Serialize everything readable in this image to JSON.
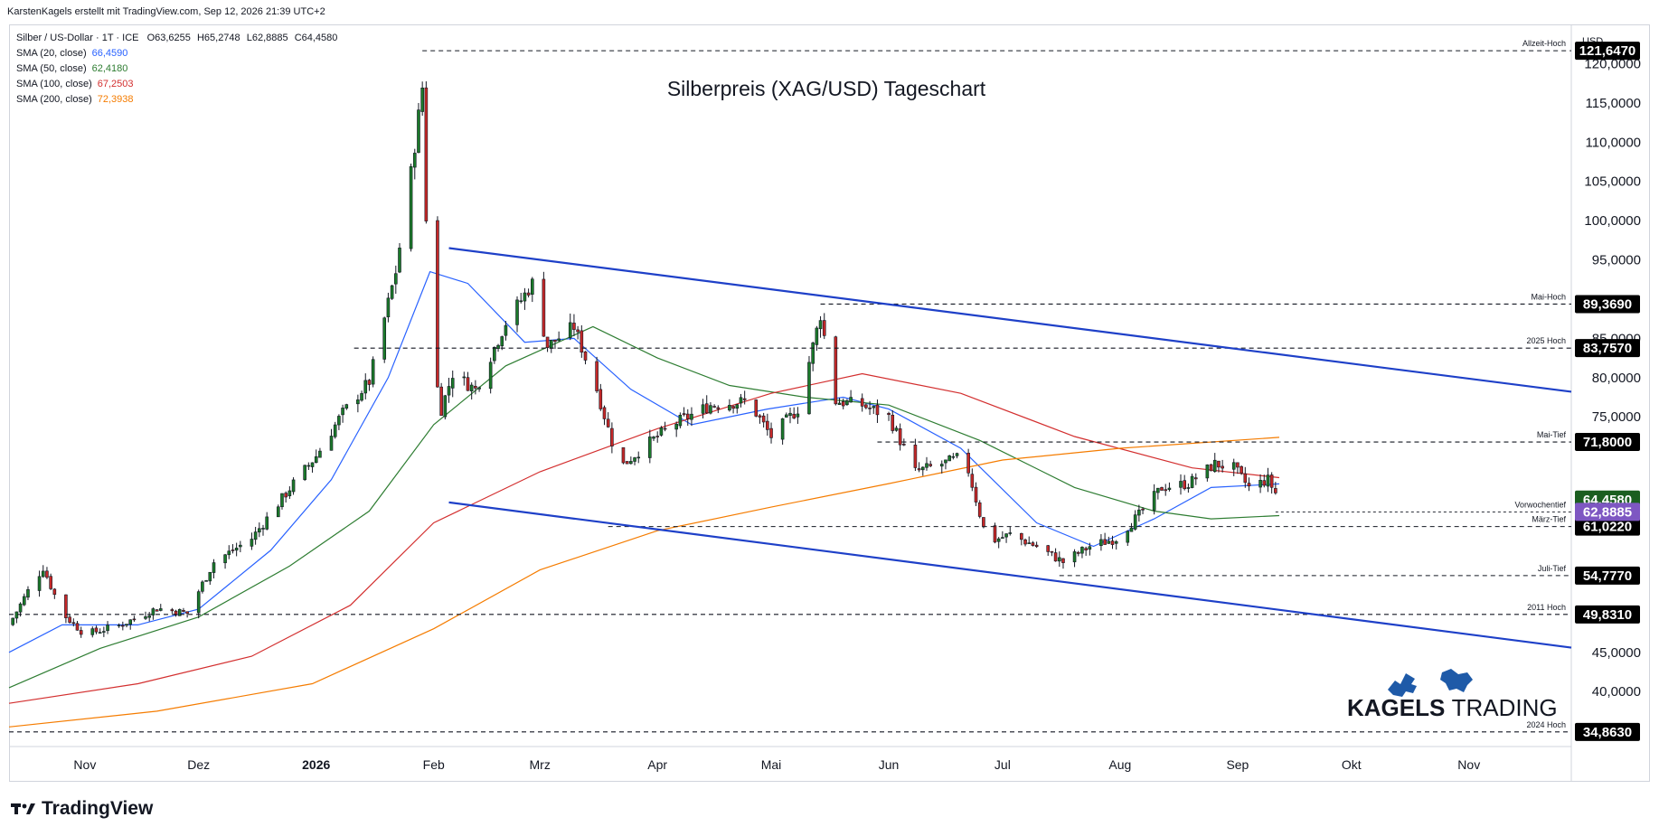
{
  "header": {
    "attribution": "KarstenKagels erstellt mit TradingView.com, Sep 12, 2026 21:39 UTC+2"
  },
  "legend": {
    "symbol_line": "Silber / US-Dollar · 1T · ICE",
    "ohlc": {
      "o": "O63,6255",
      "h": "H65,2748",
      "l": "L62,8885",
      "c": "C64,4580"
    },
    "sma": [
      {
        "label": "SMA (20, close)",
        "value": "66,4590",
        "color": "#2962ff"
      },
      {
        "label": "SMA (50, close)",
        "value": "62,4180",
        "color": "#2e7d32"
      },
      {
        "label": "SMA (100, close)",
        "value": "67,2503",
        "color": "#d32f2f"
      },
      {
        "label": "SMA (200, close)",
        "value": "72,3938",
        "color": "#f57c00"
      }
    ]
  },
  "footer": {
    "brand": "TradingView"
  },
  "watermark": {
    "word1": "KAGELS",
    "word2": "TRADING"
  },
  "chart_data": {
    "type": "candlestick",
    "title": "Silberpreis (XAG/USD) Tageschart",
    "currency_label": "USD",
    "ylim": [
      33,
      125
    ],
    "xlim": [
      "2025-10-12",
      "2026-11-28"
    ],
    "x_ticks": [
      {
        "label": "Nov",
        "date": "2025-11-01"
      },
      {
        "label": "Dez",
        "date": "2025-12-01"
      },
      {
        "label": "2026",
        "date": "2026-01-01",
        "bold": true
      },
      {
        "label": "Feb",
        "date": "2026-02-01"
      },
      {
        "label": "Mrz",
        "date": "2026-03-01"
      },
      {
        "label": "Apr",
        "date": "2026-04-01"
      },
      {
        "label": "Mai",
        "date": "2026-05-01"
      },
      {
        "label": "Jun",
        "date": "2026-06-01"
      },
      {
        "label": "Jul",
        "date": "2026-07-01"
      },
      {
        "label": "Aug",
        "date": "2026-08-01"
      },
      {
        "label": "Sep",
        "date": "2026-09-01"
      },
      {
        "label": "Okt",
        "date": "2026-10-01"
      },
      {
        "label": "Nov",
        "date": "2026-11-01"
      }
    ],
    "y_ticks": [
      {
        "v": 40,
        "label": "40,0000"
      },
      {
        "v": 45,
        "label": "45,0000"
      },
      {
        "v": 75,
        "label": "75,0000"
      },
      {
        "v": 80,
        "label": "80,0000"
      },
      {
        "v": 85,
        "label": "85,0000"
      },
      {
        "v": 95,
        "label": "95,0000"
      },
      {
        "v": 100,
        "label": "100,0000"
      },
      {
        "v": 105,
        "label": "105,0000"
      },
      {
        "v": 110,
        "label": "110,0000"
      },
      {
        "v": 115,
        "label": "115,0000"
      },
      {
        "v": 120,
        "label": "120,0000"
      }
    ],
    "levels": [
      {
        "name": "Allzeit-Hoch",
        "value": 121.647,
        "label": "121,6470",
        "start": "2026-01-29"
      },
      {
        "name": "Mai-Hoch",
        "value": 89.369,
        "label": "89,3690",
        "start": "2026-05-14"
      },
      {
        "name": "2025 Hoch",
        "value": 83.757,
        "label": "83,7570",
        "start": "2026-01-11"
      },
      {
        "name": "Mai-Tief",
        "value": 71.8,
        "label": "71,8000",
        "start": "2026-05-29"
      },
      {
        "name": "Vorwochentief",
        "value": 62.8885,
        "label": "",
        "start": "2026-09-11",
        "thin": true
      },
      {
        "name": "März-Tief",
        "value": 61.022,
        "label": "61,0220",
        "start": "2026-03-19"
      },
      {
        "name": "Juli-Tief",
        "value": 54.777,
        "label": "54,7770",
        "start": "2026-07-16"
      },
      {
        "name": "2011 Hoch",
        "value": 49.831,
        "label": "49,8310",
        "start": "2025-10-12"
      },
      {
        "name": "2024 Hoch",
        "value": 34.863,
        "label": "34,8630",
        "start": "2025-10-12"
      }
    ],
    "price_tags": [
      {
        "value": 64.458,
        "label": "64,4580",
        "color": "#1b5e20"
      },
      {
        "value": 62.8885,
        "label": "62,8885",
        "color": "#7e57c2"
      }
    ],
    "channel_lines": [
      {
        "from": [
          "2026-02-05",
          96.5
        ],
        "to": [
          "2026-11-28",
          78.2
        ]
      },
      {
        "from": [
          "2026-02-05",
          64.1
        ],
        "to": [
          "2026-11-28",
          45.6
        ]
      }
    ],
    "candles_keypoints": [
      [
        "2025-10-12",
        48.5
      ],
      [
        "2025-10-17",
        52.8
      ],
      [
        "2025-10-21",
        55.8
      ],
      [
        "2025-10-26",
        50.0
      ],
      [
        "2025-11-01",
        47.3
      ],
      [
        "2025-11-10",
        48.4
      ],
      [
        "2025-11-20",
        50.6
      ],
      [
        "2025-11-28",
        50.0
      ],
      [
        "2025-12-05",
        56.5
      ],
      [
        "2025-12-15",
        59.5
      ],
      [
        "2025-12-26",
        66.5
      ],
      [
        "2026-01-01",
        70.0
      ],
      [
        "2026-01-08",
        75.5
      ],
      [
        "2026-01-15",
        79.5
      ],
      [
        "2026-01-22",
        93.5
      ],
      [
        "2026-01-26",
        106.0
      ],
      [
        "2026-01-29",
        117.0
      ],
      [
        "2026-01-31",
        84.0
      ],
      [
        "2026-02-03",
        76.0
      ],
      [
        "2026-02-06",
        80.5
      ],
      [
        "2026-02-12",
        78.5
      ],
      [
        "2026-02-20",
        87.0
      ],
      [
        "2026-02-27",
        92.0
      ],
      [
        "2026-03-03",
        84.0
      ],
      [
        "2026-03-10",
        86.5
      ],
      [
        "2026-03-16",
        78.5
      ],
      [
        "2026-03-22",
        68.5
      ],
      [
        "2026-03-28",
        71.0
      ],
      [
        "2026-04-05",
        74.0
      ],
      [
        "2026-04-15",
        76.5
      ],
      [
        "2026-04-25",
        77.0
      ],
      [
        "2026-05-01",
        72.5
      ],
      [
        "2026-05-08",
        76.0
      ],
      [
        "2026-05-14",
        88.0
      ],
      [
        "2026-05-18",
        77.0
      ],
      [
        "2026-05-25",
        76.5
      ],
      [
        "2026-06-01",
        75.0
      ],
      [
        "2026-06-08",
        68.0
      ],
      [
        "2026-06-15",
        69.0
      ],
      [
        "2026-06-21",
        70.0
      ],
      [
        "2026-06-27",
        59.0
      ],
      [
        "2026-07-03",
        60.0
      ],
      [
        "2026-07-10",
        58.5
      ],
      [
        "2026-07-17",
        56.5
      ],
      [
        "2026-07-24",
        58.5
      ],
      [
        "2026-07-31",
        59.5
      ],
      [
        "2026-08-06",
        62.5
      ],
      [
        "2026-08-12",
        66.0
      ],
      [
        "2026-08-19",
        66.5
      ],
      [
        "2026-08-26",
        69.0
      ],
      [
        "2026-08-31",
        68.5
      ],
      [
        "2026-09-04",
        66.0
      ],
      [
        "2026-09-09",
        67.0
      ],
      [
        "2026-09-12",
        64.46
      ]
    ],
    "sma_series": {
      "SMA20": [
        [
          "2025-10-12",
          45.0
        ],
        [
          "2025-10-26",
          48.5
        ],
        [
          "2025-11-15",
          48.5
        ],
        [
          "2025-12-01",
          50.5
        ],
        [
          "2025-12-20",
          58.0
        ],
        [
          "2026-01-05",
          67.0
        ],
        [
          "2026-01-20",
          80.0
        ],
        [
          "2026-01-31",
          93.5
        ],
        [
          "2026-02-10",
          92.0
        ],
        [
          "2026-02-25",
          84.5
        ],
        [
          "2026-03-10",
          85.0
        ],
        [
          "2026-03-25",
          78.5
        ],
        [
          "2026-04-10",
          74.0
        ],
        [
          "2026-04-30",
          76.0
        ],
        [
          "2026-05-20",
          77.5
        ],
        [
          "2026-06-01",
          76.0
        ],
        [
          "2026-06-20",
          71.0
        ],
        [
          "2026-07-10",
          61.5
        ],
        [
          "2026-07-25",
          58.5
        ],
        [
          "2026-08-10",
          62.0
        ],
        [
          "2026-08-25",
          66.0
        ],
        [
          "2026-09-12",
          66.459
        ]
      ],
      "SMA50": [
        [
          "2025-10-12",
          40.5
        ],
        [
          "2025-11-05",
          45.5
        ],
        [
          "2025-12-01",
          49.5
        ],
        [
          "2025-12-25",
          56.0
        ],
        [
          "2026-01-15",
          63.0
        ],
        [
          "2026-02-01",
          74.0
        ],
        [
          "2026-02-20",
          81.5
        ],
        [
          "2026-03-15",
          86.5
        ],
        [
          "2026-04-01",
          82.5
        ],
        [
          "2026-04-20",
          79.0
        ],
        [
          "2026-05-10",
          77.5
        ],
        [
          "2026-06-01",
          76.5
        ],
        [
          "2026-06-25",
          72.0
        ],
        [
          "2026-07-20",
          66.0
        ],
        [
          "2026-08-10",
          63.0
        ],
        [
          "2026-08-25",
          62.0
        ],
        [
          "2026-09-12",
          62.418
        ]
      ],
      "SMA100": [
        [
          "2025-10-12",
          38.5
        ],
        [
          "2025-11-15",
          41.0
        ],
        [
          "2025-12-15",
          44.5
        ],
        [
          "2026-01-10",
          51.0
        ],
        [
          "2026-02-01",
          61.5
        ],
        [
          "2026-03-01",
          68.0
        ],
        [
          "2026-04-01",
          73.5
        ],
        [
          "2026-05-01",
          78.0
        ],
        [
          "2026-05-25",
          80.5
        ],
        [
          "2026-06-20",
          78.0
        ],
        [
          "2026-07-20",
          72.5
        ],
        [
          "2026-08-20",
          68.5
        ],
        [
          "2026-09-12",
          67.2503
        ]
      ],
      "SMA200": [
        [
          "2025-10-12",
          35.5
        ],
        [
          "2025-11-20",
          37.5
        ],
        [
          "2025-12-31",
          41.0
        ],
        [
          "2026-02-01",
          48.0
        ],
        [
          "2026-03-01",
          55.5
        ],
        [
          "2026-04-01",
          60.5
        ],
        [
          "2026-05-01",
          63.5
        ],
        [
          "2026-06-01",
          66.5
        ],
        [
          "2026-07-01",
          69.5
        ],
        [
          "2026-08-01",
          71.0
        ],
        [
          "2026-09-12",
          72.3938
        ]
      ]
    }
  }
}
